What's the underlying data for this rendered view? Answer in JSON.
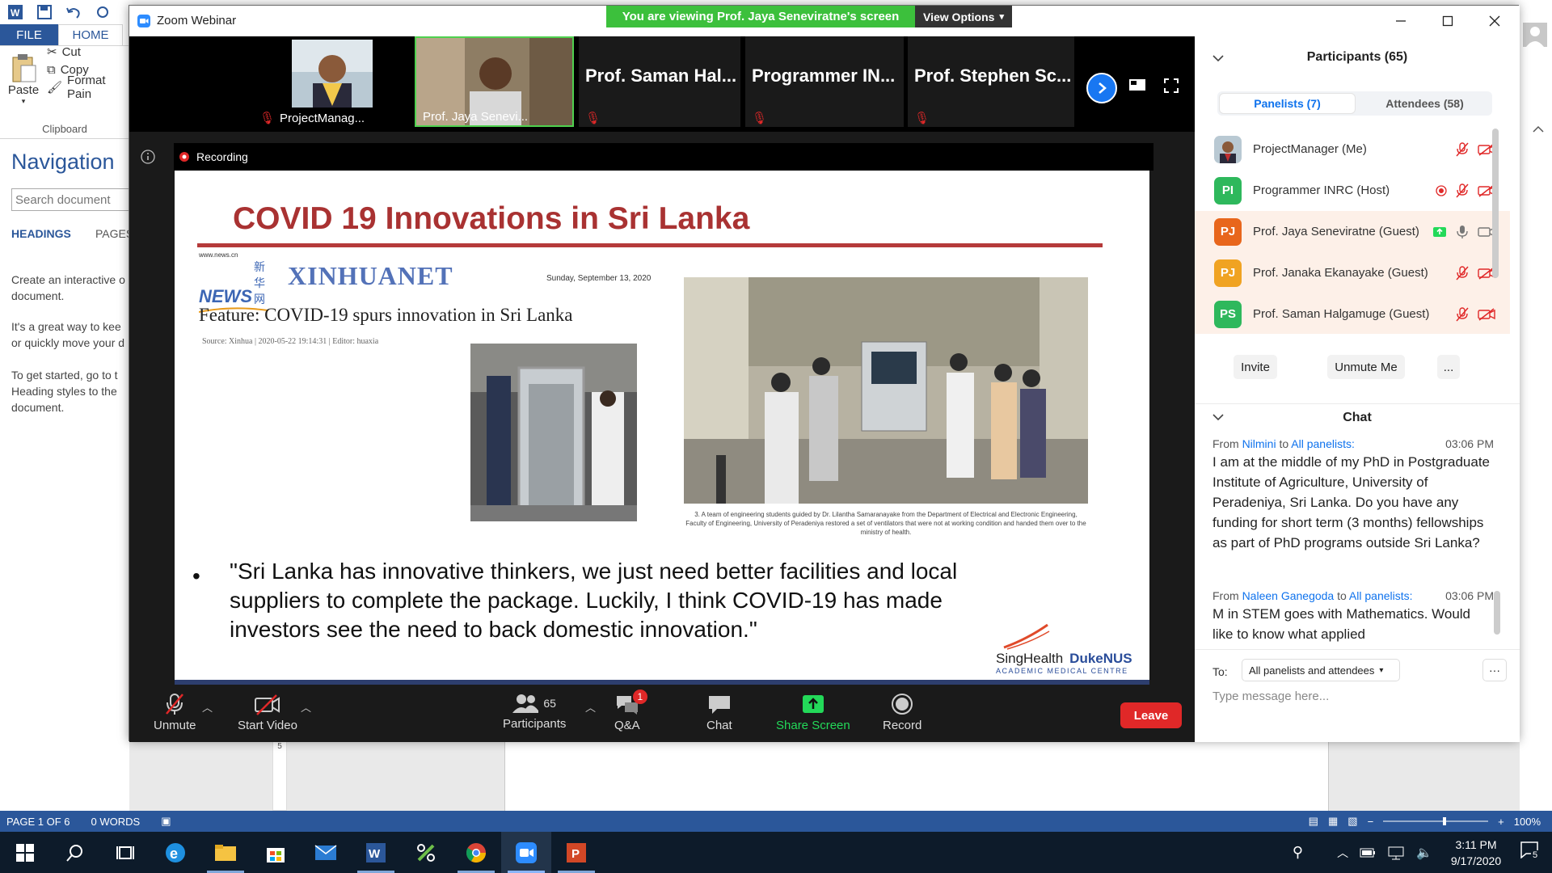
{
  "word": {
    "tabs": {
      "file": "FILE",
      "home": "HOME"
    },
    "clipboard": {
      "paste": "Paste",
      "cut": "Cut",
      "copy": "Copy",
      "format_painter": "Format Pain",
      "group_label": "Clipboard"
    },
    "navigation": {
      "title": "Navigation",
      "search_placeholder": "Search document",
      "tab_headings": "HEADINGS",
      "tab_pages": "PAGES",
      "lines": [
        "Create an interactive o",
        "document.",
        "It's a great way to kee",
        "or quickly move your d",
        "To get started, go to t",
        "Heading styles to the",
        "document."
      ]
    },
    "status": {
      "page": "PAGE 1 OF 6",
      "words": "0 WORDS",
      "zoom": "100%"
    },
    "ruler_mark": "5"
  },
  "zoom": {
    "window_title": "Zoom Webinar",
    "banner": "You are viewing Prof. Jaya Seneviratne's screen",
    "view_options": "View Options",
    "thumbnails": [
      {
        "name": "ProjectManag...",
        "video": true,
        "muted": true
      },
      {
        "name": "Prof. Jaya Senevi...",
        "video": true,
        "muted": false,
        "active": true
      },
      {
        "name": "Prof. Saman Hal...",
        "video": false,
        "muted": true
      },
      {
        "name": "Programmer IN...",
        "video": false,
        "muted": true
      },
      {
        "name": "Prof. Stephen Sc...",
        "video": false,
        "muted": true
      }
    ],
    "recording_label": "Recording",
    "slide": {
      "title": "COVID 19 Innovations in Sri Lanka",
      "xinhua_small": "www.news.cn",
      "xinhua_news": "NEWS",
      "xinhua_cn": "新华网",
      "xinhua_net": "XINHUANET",
      "date": "Sunday, September 13, 2020",
      "headline": "Feature: COVID-19 spurs innovation in Sri Lanka",
      "source": "Source: Xinhua | 2020-05-22 19:14:31 | Editor: huaxia",
      "caption": "3. A team of engineering students guided by Dr. Lilantha Samaranayake from the Department of Electrical and Electronic Engineering, Faculty of Engineering, University of Peradeniya restored a set of ventilators that were not at working condition and handed them over to the ministry of health.",
      "bullet": "•",
      "quote": "\"Sri Lanka has innovative thinkers, we just need better facilities and local suppliers to complete the package. Luckily, I think COVID-19 has made investors see the need to back domestic innovation.\"",
      "logo_sing": "SingHealth",
      "logo_duke": "DukeNUS",
      "logo_sub": "ACADEMIC MEDICAL CENTRE"
    },
    "toolbar": {
      "unmute": "Unmute",
      "start_video": "Start Video",
      "participants": "Participants",
      "participants_count": "65",
      "qa": "Q&A",
      "qa_badge": "1",
      "chat": "Chat",
      "share_screen": "Share Screen",
      "record": "Record",
      "leave": "Leave"
    },
    "panel": {
      "participants_title": "Participants (65)",
      "tab_panelists": "Panelists (7)",
      "tab_attendees": "Attendees (58)",
      "participants": [
        {
          "initials": "",
          "name": "ProjectManager (Me)",
          "color": "#ffffff",
          "photo": true,
          "recording": false,
          "share": false,
          "muted": true,
          "video_off": true
        },
        {
          "initials": "PI",
          "name": "Programmer INRC (Host)",
          "color": "#2eb85c",
          "recording": true,
          "share": false,
          "muted": true,
          "video_off": true
        },
        {
          "initials": "PJ",
          "name": "Prof. Jaya Seneviratne (Guest)",
          "color": "#e8661c",
          "recording": false,
          "share": true,
          "muted": false,
          "video_off": false
        },
        {
          "initials": "PJ",
          "name": "Prof. Janaka Ekanayake (Guest)",
          "color": "#f0a322",
          "recording": false,
          "share": false,
          "muted": true,
          "video_off": true
        },
        {
          "initials": "PS",
          "name": "Prof. Saman Halgamuge (Guest)",
          "color": "#2eb85c",
          "recording": false,
          "share": false,
          "muted": true,
          "video_off": true
        }
      ],
      "btn_invite": "Invite",
      "btn_unmute": "Unmute Me",
      "btn_more": "...",
      "chat_title": "Chat",
      "messages": [
        {
          "from_label": "From",
          "from": "Nilmini",
          "to_label": "to",
          "to": "All panelists:",
          "time": "03:06 PM",
          "text": "I am at the middle of my PhD in Postgraduate Institute of Agriculture, University of Peradeniya, Sri Lanka.  Do you have any funding for short term (3 months) fellowships as part of PhD programs outside Sri Lanka?"
        },
        {
          "from_label": "From",
          "from": "Naleen Ganegoda",
          "to_label": "to",
          "to": "All panelists:",
          "time": "03:06 PM",
          "text": "M in STEM goes with Mathematics. Would like to know what applied"
        }
      ],
      "to_label": "To:",
      "to_value": "All panelists and attendees",
      "chat_more": "···",
      "chat_placeholder": "Type message here..."
    }
  },
  "taskbar": {
    "time": "3:11 PM",
    "date": "9/17/2020",
    "notif_count": "5"
  },
  "colors": {
    "word_blue": "#2b579a",
    "zoom_blue": "#0e72ed",
    "leave_red": "#e02828",
    "share_green": "#23d959"
  }
}
